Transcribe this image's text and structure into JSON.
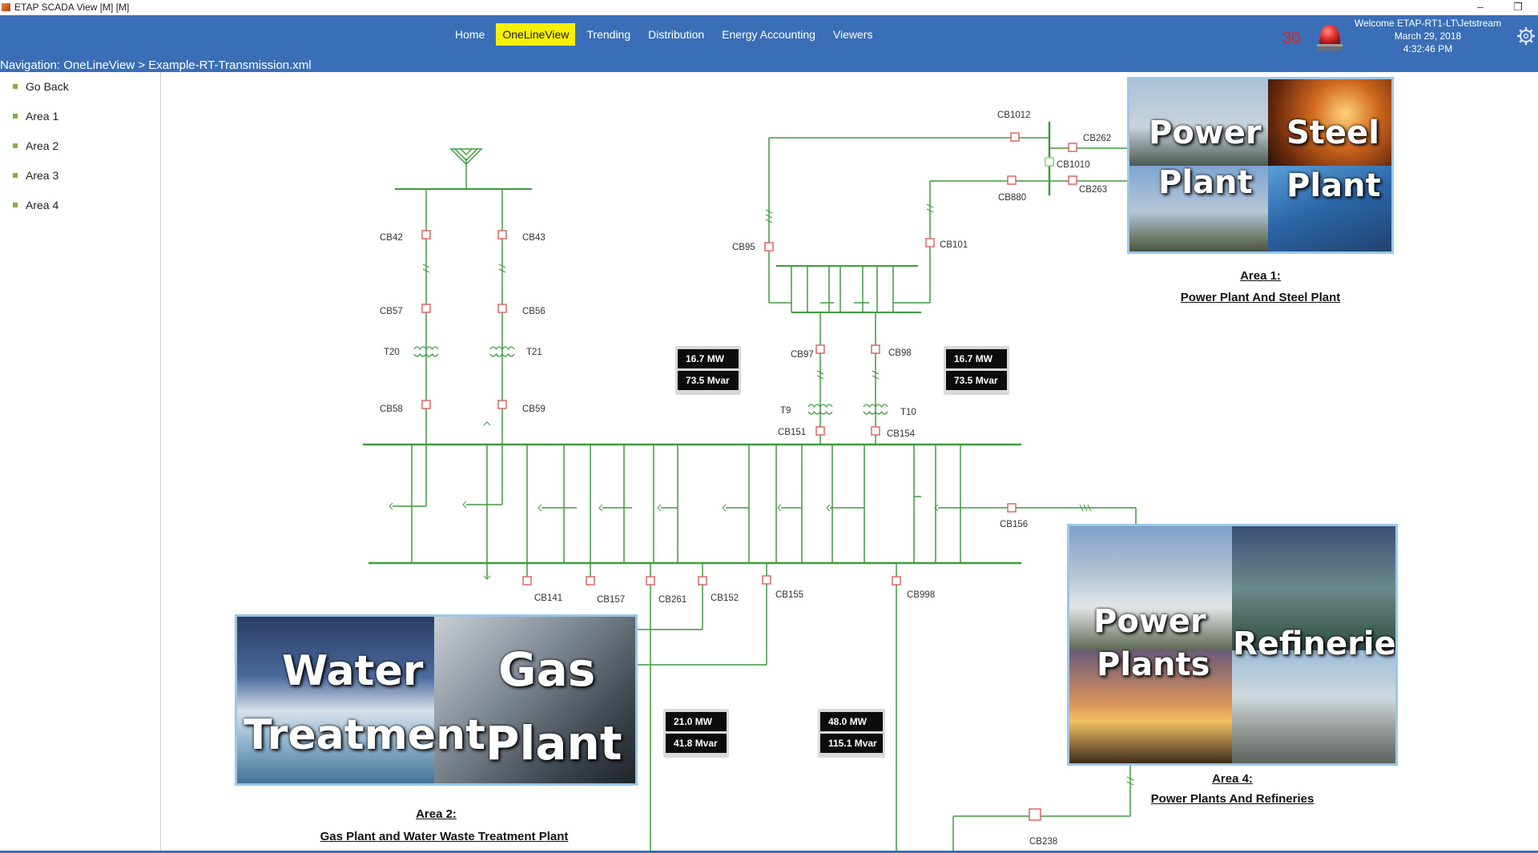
{
  "window": {
    "title": "ETAP SCADA View [M]  [M]",
    "min_glyph": "–",
    "restore_glyph": "❐"
  },
  "header": {
    "menu": [
      "Home",
      "OneLineView",
      "Trending",
      "Distribution",
      "Energy Accounting",
      "Viewers"
    ],
    "active_menu": "OneLineView",
    "alarm_count": "30",
    "welcome": "Welcome ETAP-RT1-LT\\Jetstream",
    "date": "March 29, 2018",
    "time": "4:32:46 PM",
    "breadcrumb": "Navigation: OneLineView > Example-RT-Transmission.xml"
  },
  "sidebar": {
    "items": [
      "Go Back",
      "Area 1",
      "Area 2",
      "Area 3",
      "Area 4"
    ]
  },
  "breakers": {
    "cb1012": "CB1012",
    "cb262": "CB262",
    "cb1010": "CB1010",
    "cb880": "CB880",
    "cb263": "CB263",
    "cb95": "CB95",
    "cb101": "CB101",
    "cb42": "CB42",
    "cb43": "CB43",
    "cb57": "CB57",
    "cb56": "CB56",
    "cb58": "CB58",
    "cb59": "CB59",
    "cb97": "CB97",
    "cb98": "CB98",
    "cb151": "CB151",
    "cb154": "CB154",
    "cb156": "CB156",
    "cb141": "CB141",
    "cb157": "CB157",
    "cb261": "CB261",
    "cb152": "CB152",
    "cb155": "CB155",
    "cb998": "CB998",
    "cb238": "CB238"
  },
  "transformers": {
    "t20": "T20",
    "t21": "T21",
    "t9": "T9",
    "t10": "T10"
  },
  "meters": {
    "m1": {
      "mw": "16.7 MW",
      "mvar": "73.5 Mvar"
    },
    "m2": {
      "mw": "16.7 MW",
      "mvar": "73.5 Mvar"
    },
    "m3": {
      "mw": "21.0 MW",
      "mvar": "41.8 Mvar"
    },
    "m4": {
      "mw": "48.0 MW",
      "mvar": "115.1 Mvar"
    }
  },
  "areas": {
    "area1": {
      "title": "Area 1:",
      "subtitle": "Power Plant And Steel Plant",
      "tile_words": [
        "Power",
        "Steel",
        "Plant",
        "Plant"
      ]
    },
    "area2": {
      "title": "Area 2:",
      "subtitle": "Gas Plant and Water Waste Treatment Plant",
      "tile_words": [
        "Water",
        "Treatment",
        "Gas",
        "Plant"
      ]
    },
    "area4": {
      "title": "Area 4:",
      "subtitle": "Power Plants And Refineries",
      "tile_words": [
        "Power",
        "Plants",
        "Refineries"
      ]
    }
  },
  "colors": {
    "header_bg": "#3a6fb8",
    "active_menu_bg": "#f7f000",
    "line": "#3f9b3f",
    "breaker": "#e06565",
    "alarm": "#e0241b",
    "bullet": "#7cb342"
  },
  "icons": [
    "app-icon",
    "alarm-beacon-icon",
    "gear-icon",
    "bullet-icon",
    "antenna-icon"
  ]
}
